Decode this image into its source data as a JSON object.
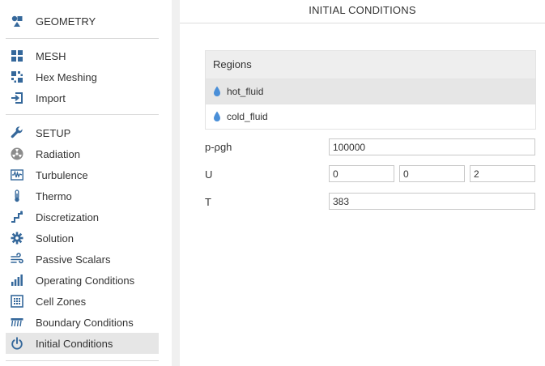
{
  "sidebar": {
    "items": [
      {
        "id": "geometry",
        "label": "GEOMETRY",
        "icon": "geometry-icon"
      },
      {
        "id": "mesh",
        "label": "MESH",
        "icon": "mesh-icon"
      },
      {
        "id": "hex-meshing",
        "label": "Hex Meshing",
        "icon": "hex-meshing-icon"
      },
      {
        "id": "import",
        "label": "Import",
        "icon": "import-icon"
      },
      {
        "id": "setup",
        "label": "SETUP",
        "icon": "wrench-icon"
      },
      {
        "id": "radiation",
        "label": "Radiation",
        "icon": "radiation-icon"
      },
      {
        "id": "turbulence",
        "label": "Turbulence",
        "icon": "turbulence-icon"
      },
      {
        "id": "thermo",
        "label": "Thermo",
        "icon": "thermometer-icon"
      },
      {
        "id": "discretization",
        "label": "Discretization",
        "icon": "discretization-icon"
      },
      {
        "id": "solution",
        "label": "Solution",
        "icon": "gear-icon"
      },
      {
        "id": "passive-scalars",
        "label": "Passive Scalars",
        "icon": "wind-icon"
      },
      {
        "id": "operating-conditions",
        "label": "Operating Conditions",
        "icon": "bar-chart-icon"
      },
      {
        "id": "cell-zones",
        "label": "Cell Zones",
        "icon": "cell-zones-icon"
      },
      {
        "id": "boundary-conditions",
        "label": "Boundary Conditions",
        "icon": "boundary-icon"
      },
      {
        "id": "initial-conditions",
        "label": "Initial Conditions",
        "icon": "power-icon",
        "active": true
      }
    ]
  },
  "panel": {
    "title": "INITIAL CONDITIONS",
    "regions": {
      "header": "Regions",
      "items": [
        {
          "name": "hot_fluid",
          "selected": true
        },
        {
          "name": "cold_fluid",
          "selected": false
        }
      ]
    },
    "fields": {
      "p_rgh": {
        "label": "p-ρgh",
        "value": "100000"
      },
      "U": {
        "label": "U",
        "values": [
          "0",
          "0",
          "2"
        ]
      },
      "T": {
        "label": "T",
        "value": "383"
      }
    }
  },
  "colors": {
    "icon": "#35689b",
    "drop": "#4a8fd8",
    "active_bg": "#e6e6e6",
    "divider": "#d9d9d9"
  }
}
